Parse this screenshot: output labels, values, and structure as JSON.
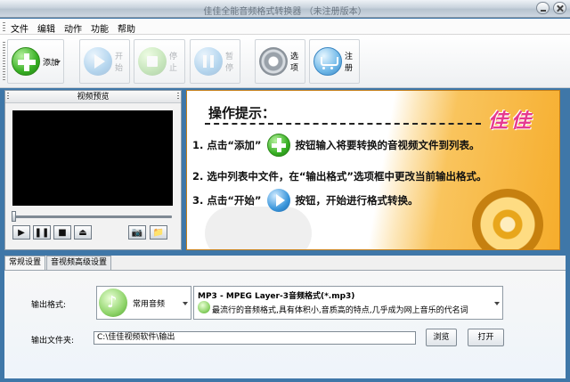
{
  "window": {
    "title": "佳佳全能音频格式转换器 （未注册版本）"
  },
  "menu": {
    "items": [
      "文件",
      "编辑",
      "动作",
      "功能",
      "帮助"
    ]
  },
  "toolbar": {
    "add": "添加",
    "start": "开始",
    "stop": "停止",
    "pause": "暂停",
    "options": "选项",
    "register": "注册"
  },
  "preview": {
    "title": "视频预览",
    "controls": [
      "▶",
      "❚❚",
      "■",
      "⏏"
    ],
    "extra_controls": [
      "📷",
      "📁"
    ]
  },
  "hints": {
    "title": "操作提示：",
    "brand": "佳佳",
    "step1_a": "1. 点击“添加”",
    "step1_b": "按钮输入将要转换的音视频文件到列表。",
    "step2": "2. 选中列表中文件，在“输出格式”选项框中更改当前输出格式。",
    "step3_a": "3. 点击“开始”",
    "step3_b": "按钮，开始进行格式转换。"
  },
  "tabs": [
    "常规设置",
    "音视频高级设置"
  ],
  "settings": {
    "format_label": "输出格式:",
    "format_category": "常用音频",
    "format_name": "MP3 - MPEG Layer-3音频格式(*.mp3)",
    "format_desc": "最流行的音频格式,具有体积小,音质高的特点,几乎成为网上音乐的代名词",
    "folder_label": "输出文件夹:",
    "folder_path": "C:\\佳佳视频软件\\输出",
    "browse": "浏览",
    "open": "打开"
  }
}
